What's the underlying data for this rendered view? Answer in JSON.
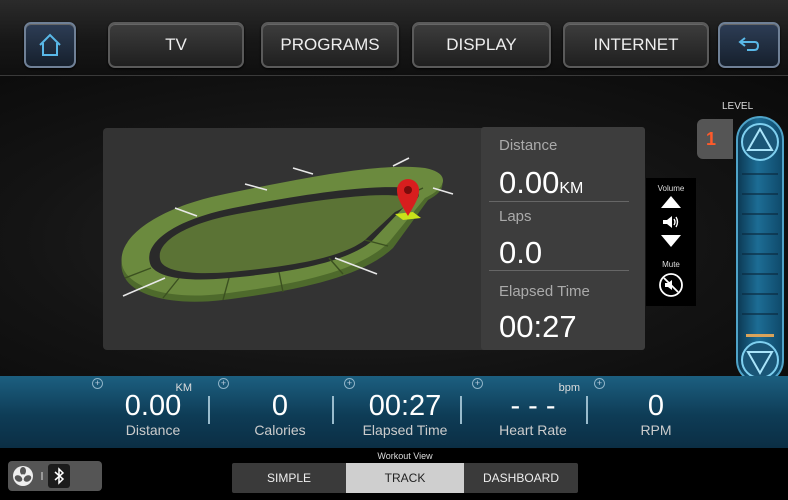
{
  "topbar": {
    "home_icon": "home-icon",
    "tabs": [
      "TV",
      "PROGRAMS",
      "DISPLAY",
      "INTERNET"
    ],
    "back_icon": "back-arrow-icon"
  },
  "track_info": {
    "distance_label": "Distance",
    "distance_value": "0.00",
    "distance_unit": "KM",
    "laps_label": "Laps",
    "laps_value": "0.0",
    "elapsed_label": "Elapsed Time",
    "elapsed_value": "00:27"
  },
  "volume": {
    "label": "Volume",
    "mute_label": "Mute"
  },
  "level": {
    "label": "LEVEL",
    "value": "1",
    "position_fraction": 0.0
  },
  "stats": [
    {
      "value": "0.00",
      "label": "Distance",
      "unit": "KM"
    },
    {
      "value": "0",
      "label": "Calories",
      "unit": ""
    },
    {
      "value": "00:27",
      "label": "Elapsed Time",
      "unit": ""
    },
    {
      "value": "- - -",
      "label": "Heart Rate",
      "unit": "bpm"
    },
    {
      "value": "0",
      "label": "RPM",
      "unit": ""
    }
  ],
  "workout_view": {
    "label": "Workout View",
    "tabs": [
      "SIMPLE",
      "TRACK",
      "DASHBOARD"
    ],
    "selected": "TRACK"
  },
  "colors": {
    "accent": "#1d6d95",
    "track_green": "#5d7a35",
    "level_number": "#ff5a2a",
    "pin_red": "#d81e1e"
  }
}
